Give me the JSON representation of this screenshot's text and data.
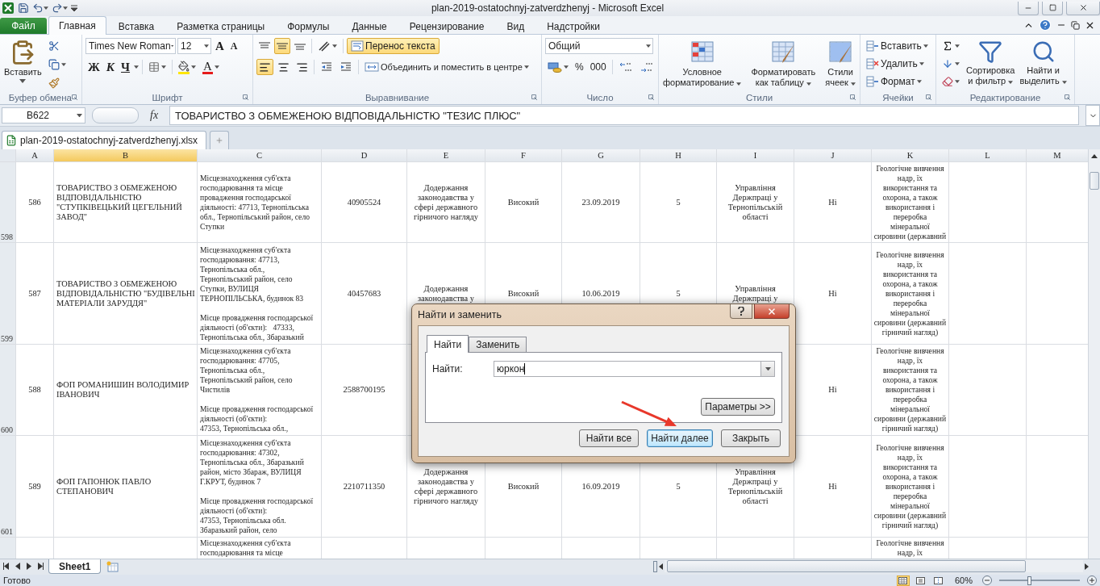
{
  "title_bar": {
    "title": "plan-2019-ostatochnyj-zatverdzhenyj  -  Microsoft Excel"
  },
  "ribbon_tabs": [
    {
      "label": "Файл",
      "kind": "file",
      "selected": false
    },
    {
      "label": "Главная",
      "kind": "tab",
      "selected": true
    },
    {
      "label": "Вставка",
      "kind": "tab",
      "selected": false
    },
    {
      "label": "Разметка страницы",
      "kind": "tab",
      "selected": false
    },
    {
      "label": "Формулы",
      "kind": "tab",
      "selected": false
    },
    {
      "label": "Данные",
      "kind": "tab",
      "selected": false
    },
    {
      "label": "Рецензирование",
      "kind": "tab",
      "selected": false
    },
    {
      "label": "Вид",
      "kind": "tab",
      "selected": false
    },
    {
      "label": "Надстройки",
      "kind": "tab",
      "selected": false
    }
  ],
  "ribbon": {
    "clipboard": {
      "label": "Буфер обмена",
      "paste": "Вставить"
    },
    "font": {
      "label": "Шрифт",
      "font_name": "Times New Roman",
      "font_size": "12",
      "grow": "A",
      "shrink": "A",
      "bold": "Ж",
      "italic": "К",
      "underline": "Ч",
      "font_color": "A"
    },
    "alignment": {
      "label": "Выравнивание",
      "vertical": [
        {
          "selected": false
        },
        {
          "selected": true
        },
        {
          "selected": false
        }
      ],
      "horizontal": [
        {
          "selected": true
        },
        {
          "selected": false
        },
        {
          "selected": false
        }
      ],
      "wrap_text": {
        "label": "Перенос текста",
        "on": true
      },
      "merge": "Объединить и поместить в центре"
    },
    "number": {
      "label": "Число",
      "format": "Общий",
      "percent": "%",
      "thousands": "000"
    },
    "styles": {
      "label": "Стили",
      "buttons": [
        {
          "lines": [
            "Условное",
            "форматирование"
          ]
        },
        {
          "lines": [
            "Форматировать",
            "как таблицу"
          ]
        },
        {
          "lines": [
            "Стили",
            "ячеек"
          ]
        }
      ]
    },
    "cells": {
      "label": "Ячейки",
      "buttons": [
        "Вставить",
        "Удалить",
        "Формат"
      ]
    },
    "editing": {
      "label": "Редактирование",
      "buttons": [
        {
          "lines": [
            "Сортировка",
            "и фильтр"
          ]
        },
        {
          "lines": [
            "Найти и",
            "выделить"
          ]
        }
      ]
    }
  },
  "formula_bar": {
    "name_box": "B622",
    "function_label": "fx",
    "content": "ТОВАРИСТВО З ОБМЕЖЕНОЮ ВІДПОВІДАЛЬНІСТЮ \"ТЕЗИС ПЛЮС\""
  },
  "workbook_tabs": [
    {
      "label": "plan-2019-ostatochnyj-zatverdzhenyj.xlsx",
      "selected": true
    }
  ],
  "columns": [
    {
      "label": "A",
      "selected": false
    },
    {
      "label": "B",
      "selected": true
    },
    {
      "label": "C",
      "selected": false
    },
    {
      "label": "D",
      "selected": false
    },
    {
      "label": "E",
      "selected": false
    },
    {
      "label": "F",
      "selected": false
    },
    {
      "label": "G",
      "selected": false
    },
    {
      "label": "H",
      "selected": false
    },
    {
      "label": "I",
      "selected": false
    },
    {
      "label": "J",
      "selected": false
    },
    {
      "label": "K",
      "selected": false
    },
    {
      "label": "L",
      "selected": false
    },
    {
      "label": "M",
      "selected": false
    }
  ],
  "rows": [
    {
      "header": "598",
      "cells": [
        "586",
        "ТОВАРИСТВО З ОБМЕЖЕНОЮ\nВІДПОВІДАЛЬНІСТЮ\n\"СТУПКІВЕЦЬКИЙ ЦЕГЕЛЬНИЙ\nЗАВОД\"",
        "Місцезнаходження суб'єкта\nгосподарювання та місце\nпровадження господарської\nдіяльності: 47713, Тернопільська\nобл., Тернопільський район, село\nСтупки",
        "40905524",
        "Додержання\nзаконодавства у\nсфері державного\nгірничого нагляду",
        "Високий",
        "23.09.2019",
        "5",
        "Управління\nДержпраці у\nТернопільській\nобласті",
        "Ні",
        "Геологічне вивчення\nнадр, їх\nвикористання та\nохорона, а також\nвикористання і\nпереробка\nмінеральної\nсировини (державний",
        null,
        null
      ]
    },
    {
      "header": "599",
      "cells": [
        "587",
        "ТОВАРИСТВО З ОБМЕЖЕНОЮ\nВІДПОВІДАЛЬНІСТЮ \"БУДІВЕЛЬНІ\nМАТЕРІАЛИ ЗАРУДДЯ\"",
        "Місцезнаходження суб'єкта\nгосподарювання: 47713,\nТернопільська обл.,\nТернопільський район, село\nСтупки, ВУЛИЦЯ\nТЕРНОПІЛЬСЬКА, будинок 83\n\nМісце провадження господарської\nдіяльності (об'єкти):   47333,\nТернопільська обл., Збаразький",
        "40457683",
        "Додержання\nзаконодавства у",
        "Високий",
        "10.06.2019",
        "5",
        "Управління\nДержпраці у",
        "Ні",
        "Геологічне вивчення\nнадр, їх\nвикористання та\nохорона, а також\nвикористання і\nпереробка\nмінеральної\nсировини (державний\nгірничий нагляд)",
        null,
        null
      ]
    },
    {
      "header": "600",
      "cells": [
        "588",
        "ФОП РОМАНИШИН ВОЛОДИМИР\nІВАНОВИЧ",
        "Місцезнаходження суб'єкта\nгосподарювання: 47705,\nТернопільська обл.,\nТернопільський район, село\nЧистилів\n\nМісце провадження господарської\nдіяльності (об'єкти):\n47353, Тернопільська обл.,",
        "2588700195",
        null,
        null,
        null,
        null,
        null,
        "Ні",
        "Геологічне вивчення\nнадр, їх\nвикористання та\nохорона, а також\nвикористання і\nпереробка\nмінеральної\nсировини (державний\nгірничий нагляд)",
        null,
        null
      ]
    },
    {
      "header": "601",
      "cells": [
        "589",
        "ФОП ГАПОНЮК ПАВЛО\nСТЕПАНОВИЧ",
        "Місцезнаходження суб'єкта\nгосподарювання: 47302,\nТернопільська обл., Збаразький\nрайон, місто Збараж, ВУЛИЦЯ\nГ.КРУТ, будинок 7\n\nМісце провадження господарської\nдіяльності (об'єкти):\n47353, Тернопільська обл.\nЗбаразький район, село",
        "2210711350",
        "Додержання\nзаконодавства у\nсфері державного\nгірничого нагляду",
        "Високий",
        "16.09.2019",
        "5",
        "Управління\nДержпраці у\nТернопільській\nобласті",
        "Ні",
        "Геологічне вивчення\nнадр, їх\nвикористання та\nохорона, а також\nвикористання і\nпереробка\nмінеральної\nсировини (державний\nгірничий нагляд)",
        null,
        null
      ]
    },
    {
      "cells": [
        null,
        null,
        "Місцезнаходження суб'єкта\nгосподарювання та місце",
        null,
        null,
        null,
        null,
        null,
        null,
        null,
        "Геологічне вивчення\nнадр, їх",
        null,
        null
      ]
    }
  ],
  "sheet_tabs": [
    {
      "label": "Sheet1",
      "selected": true
    }
  ],
  "status_bar": {
    "status": "Готово",
    "view_buttons": [
      {
        "selected": true
      },
      {
        "selected": false
      },
      {
        "selected": false
      }
    ],
    "zoom": "60%",
    "zoom_slider": {
      "level": 0.37
    }
  },
  "dialog": {
    "title": "Найти и заменить",
    "tabs": [
      {
        "label": "Найти",
        "selected": true
      },
      {
        "label": "Заменить",
        "selected": false
      }
    ],
    "find_label": "Найти:",
    "find_value": "юркон",
    "options_button": "Параметры >>",
    "buttons": [
      {
        "label": "Найти все",
        "default": false
      },
      {
        "label": "Найти далее",
        "default": true
      },
      {
        "label": "Закрыть",
        "default": false
      }
    ]
  }
}
